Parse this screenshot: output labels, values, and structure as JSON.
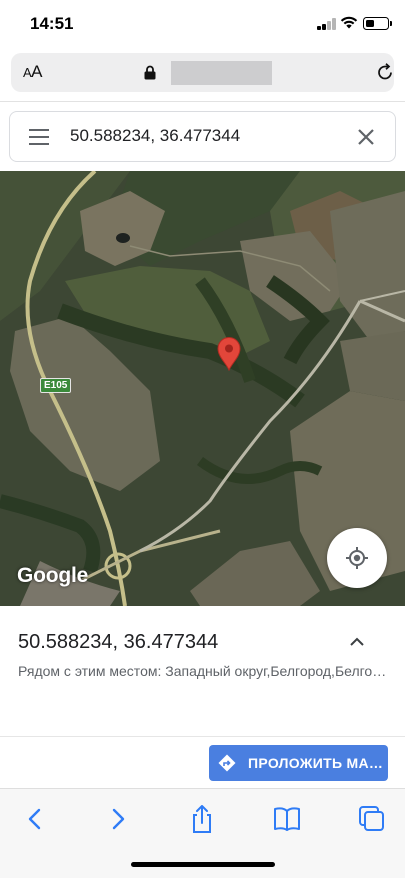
{
  "status_bar": {
    "time": "14:51",
    "battery_level": 0.4
  },
  "browser": {
    "text_size_label": "AA",
    "reload_icon": "reload-icon",
    "lock_icon": "lock-icon"
  },
  "search": {
    "query": "50.588234, 36.477344",
    "menu_icon": "hamburger-menu-icon",
    "clear_icon": "close-icon"
  },
  "map": {
    "attribution": "Google",
    "road_label": "E105",
    "marker_icon": "map-pin-icon",
    "my_location_icon": "my-location-icon",
    "type": "satellite"
  },
  "place": {
    "coordinates": "50.588234, 36.477344",
    "nearby": "Рядом с этим местом: Западный округ,Белгород,Белгородская область",
    "expand_icon": "chevron-up-icon"
  },
  "actions": {
    "directions_label": "ПРОЛОЖИТЬ МАРШРУТ",
    "directions_icon": "directions-icon",
    "accent": "#4a7fe0"
  },
  "safari_toolbar": {
    "items": [
      "back-icon",
      "forward-icon",
      "share-icon",
      "bookmarks-icon",
      "tabs-icon"
    ],
    "accent": "#2f7cf6"
  }
}
